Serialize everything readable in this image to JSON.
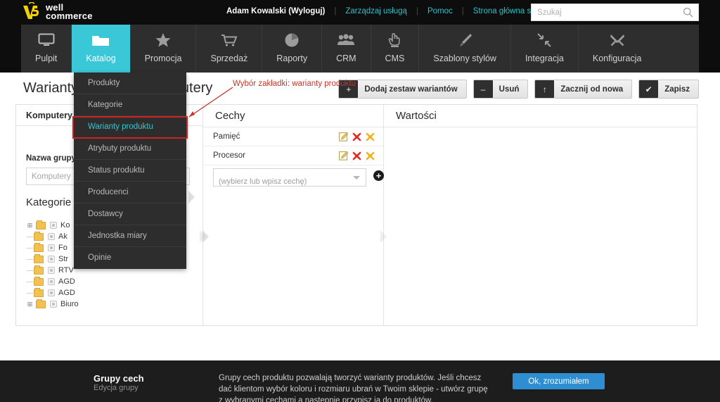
{
  "brand": {
    "line1": "well",
    "line2": "commerce",
    "accent": "#3ac8d8",
    "logo_color": "#f2d200"
  },
  "header": {
    "user": "Adam Kowalski",
    "logout": "(Wyloguj)",
    "links": [
      {
        "label": "Zarządzaj usługą"
      },
      {
        "label": "Pomoc"
      },
      {
        "label": "Strona główna sklepu"
      }
    ],
    "search_placeholder": "Szukaj",
    "search_value": ""
  },
  "nav": {
    "items": [
      {
        "label": "Pulpit",
        "icon": "monitor-icon",
        "active": false
      },
      {
        "label": "Katalog",
        "icon": "folder-icon",
        "active": true
      },
      {
        "label": "Promocja",
        "icon": "star-icon",
        "active": false
      },
      {
        "label": "Sprzedaż",
        "icon": "cart-icon",
        "active": false
      },
      {
        "label": "Raporty",
        "icon": "pie-chart-icon",
        "active": false
      },
      {
        "label": "CRM",
        "icon": "users-icon",
        "active": false
      },
      {
        "label": "CMS",
        "icon": "hand-icon",
        "active": false
      },
      {
        "label": "Szablony stylów",
        "icon": "brush-icon",
        "active": false
      },
      {
        "label": "Integracja",
        "icon": "arrows-in-icon",
        "active": false
      },
      {
        "label": "Konfiguracja",
        "icon": "tools-icon",
        "active": false
      }
    ]
  },
  "dropdown": {
    "items": [
      {
        "label": "Produkty",
        "selected": false
      },
      {
        "label": "Kategorie",
        "selected": false
      },
      {
        "label": "Warianty produktu",
        "selected": true
      },
      {
        "label": "Atrybuty produktu",
        "selected": false
      },
      {
        "label": "Status produktu",
        "selected": false
      },
      {
        "label": "Producenci",
        "selected": false
      },
      {
        "label": "Dostawcy",
        "selected": false
      },
      {
        "label": "Jednostka miary",
        "selected": false
      },
      {
        "label": "Opinie",
        "selected": false
      }
    ]
  },
  "page": {
    "title": "Warianty produktu: Komputery",
    "annotation": "Wybór zakładki: warianty produktu",
    "annotation_color": "#c0392b"
  },
  "toolbar": {
    "buttons": [
      {
        "label": "Dodaj zestaw wariantów",
        "icon": "plus-icon",
        "glyph": "+"
      },
      {
        "label": "Usuń",
        "icon": "minus-icon",
        "glyph": "–"
      },
      {
        "label": "Zacznij od nowa",
        "icon": "up-arrow-icon",
        "glyph": "↑"
      },
      {
        "label": "Zapisz",
        "icon": "check-icon",
        "glyph": "✔"
      }
    ]
  },
  "panels": {
    "left": {
      "tab_label": "Komputery",
      "field_label": "Nazwa grupy",
      "field_placeholder": "Komputery",
      "field_value": "",
      "categories_title": "Kategorie",
      "tree": [
        {
          "label": "Ko",
          "expandable": true,
          "depth": 0
        },
        {
          "label": "Ak",
          "expandable": false,
          "depth": 1
        },
        {
          "label": "Fo",
          "expandable": false,
          "depth": 1
        },
        {
          "label": "Str",
          "expandable": false,
          "depth": 1
        },
        {
          "label": "RTV",
          "expandable": false,
          "depth": 1
        },
        {
          "label": "AGD",
          "expandable": false,
          "depth": 1
        },
        {
          "label": "AGD",
          "expandable": false,
          "depth": 1
        },
        {
          "label": "Biuro",
          "expandable": true,
          "depth": 0
        }
      ]
    },
    "middle": {
      "title": "Cechy",
      "rows": [
        {
          "name": "Pamięć"
        },
        {
          "name": "Procesor"
        }
      ],
      "combo_placeholder": "(wybierz lub wpisz cechę)",
      "add_label": "+"
    },
    "right": {
      "title": "Wartości",
      "rows": []
    }
  },
  "footer": {
    "title": "Grupy cech",
    "subtitle": "Edycja grupy",
    "body": "Grupy cech produktu pozwalają tworzyć warianty produktów. Jeśli chcesz dać klientom wybór koloru i rozmiaru ubrań w Twoim sklepie - utwórz grupę z wybranymi cechami a następnie przypisz ją do produktów.",
    "button": "Ok, zrozumiałem",
    "button_color": "#2f8ed1"
  }
}
